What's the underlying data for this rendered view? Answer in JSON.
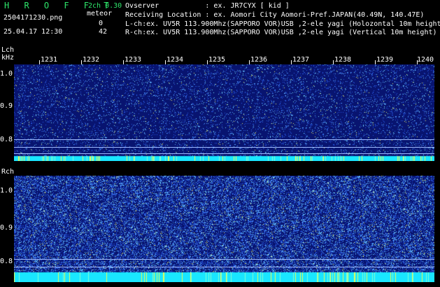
{
  "header": {
    "app_title": "H R O F F T",
    "version": "2ch 0.30",
    "filename": "2504171230.png",
    "datetime": "25.04.17 12:30",
    "meteor_label": "meteor",
    "lch_count": "0",
    "rch_count": "42"
  },
  "info": {
    "observer": "Ovserver           : ex. JR7CYX [ kid ]",
    "location": "Receiving Location : ex. Aomori City Aomori-Pref.JAPAN(40.49N, 140.47E)",
    "lch": "L-ch:ex. UV5R 113.900Mhz(SAPPORO VOR)USB ,2-ele yagi (Holozontal 10m height)",
    "rch": "R-ch:ex. UV5R 113.900Mhz(SAPPORO VOR)USB ,2-ele yagi (Vertical 10m height)"
  },
  "lch_panel": {
    "channel": "Lch",
    "unit": "kHz",
    "y_ticks": [
      "1.0",
      "0.9",
      "0.8"
    ],
    "x_ticks": [
      "1231",
      "1232",
      "1233",
      "1234",
      "1235",
      "1236",
      "1237",
      "1238",
      "1239",
      "1240"
    ]
  },
  "rch_panel": {
    "channel": "Rch",
    "y_ticks": [
      "1.0",
      "0.9",
      "0.8"
    ]
  },
  "colors": {
    "background": "#000000",
    "label_green": "#2ee66b",
    "waterfall_base": "#0a1a8c",
    "baseband": "#00ffff"
  }
}
